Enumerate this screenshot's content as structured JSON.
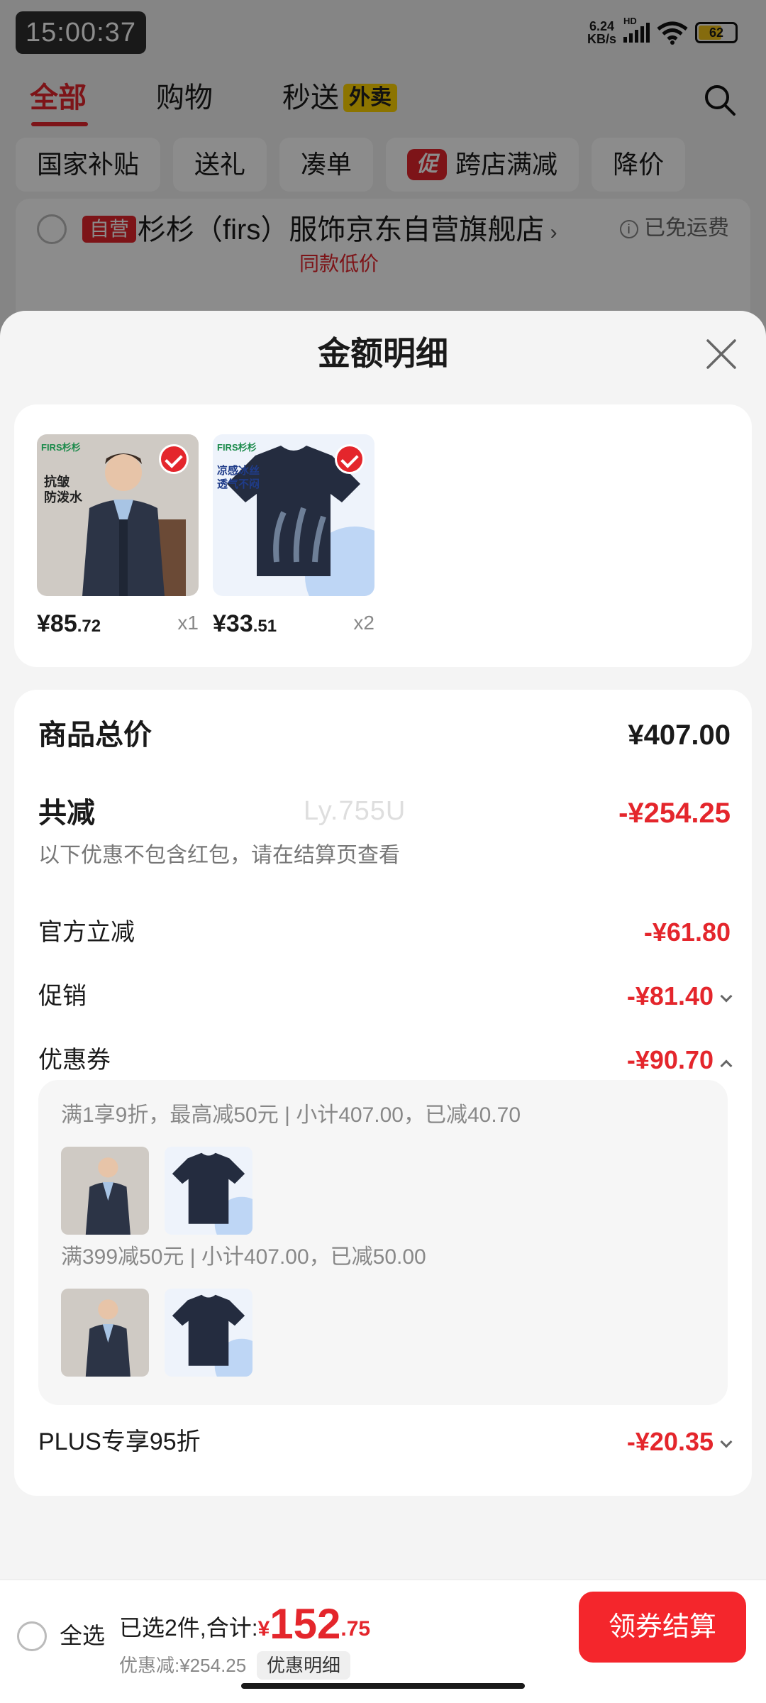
{
  "status_bar": {
    "time": "15:00:37",
    "net_speed_value": "6.24",
    "net_speed_unit": "KB/s",
    "hd": "HD",
    "battery": "62"
  },
  "top_tabs": [
    {
      "label": "全部"
    },
    {
      "label": "购物"
    },
    {
      "label": "秒送",
      "badge": "外卖"
    }
  ],
  "chips": [
    "国家补贴",
    "送礼",
    "凑单",
    "跨店满减",
    "降价"
  ],
  "chip_promo_badge": "促",
  "store": {
    "badge": "自营",
    "name": "杉杉（firs）服饰京东自营旗舰店",
    "shipping": "已免运费",
    "tag": "同款低价"
  },
  "sheet": {
    "title": "金额明细"
  },
  "products": [
    {
      "brand": "FIRS杉杉",
      "tag_lines": [
        "抗皱",
        "防泼水"
      ],
      "price_int": "¥85",
      "price_dec": ".72",
      "qty": "x1"
    },
    {
      "brand": "FIRS杉杉",
      "tag_lines": [
        "凉感冰丝",
        "透气不闷"
      ],
      "price_int": "¥33",
      "price_dec": ".51",
      "qty": "x2"
    }
  ],
  "summary": {
    "total_label": "商品总价",
    "total_value": "¥407.00",
    "reduce_label": "共减",
    "reduce_value": "-¥254.25",
    "note": "以下优惠不包含红包，请在结算页查看",
    "official_label": "官方立减",
    "official_value": "-¥61.80",
    "promo_label": "促销",
    "promo_value": "-¥81.40",
    "coupon_label": "优惠券",
    "coupon_value": "-¥90.70",
    "coupons": [
      {
        "text": "满1享9折，最高减50元 | 小计407.00，已减40.70"
      },
      {
        "text": "满399减50元 | 小计407.00，已减50.00"
      }
    ],
    "plus_label": "PLUS专享95折",
    "plus_value": "-¥20.35"
  },
  "watermark": "Ly.755U",
  "bottom_bar": {
    "select_all": "全选",
    "selected_prefix": "已选2件,合计:",
    "total_currency": "¥",
    "total_int": "152",
    "total_dec": ".75",
    "discount": "优惠减:¥254.25",
    "detail_chip": "优惠明细",
    "checkout": "领券结算"
  },
  "colors": {
    "accent_red": "#e4262c",
    "waimai_yellow": "#ffd400"
  }
}
